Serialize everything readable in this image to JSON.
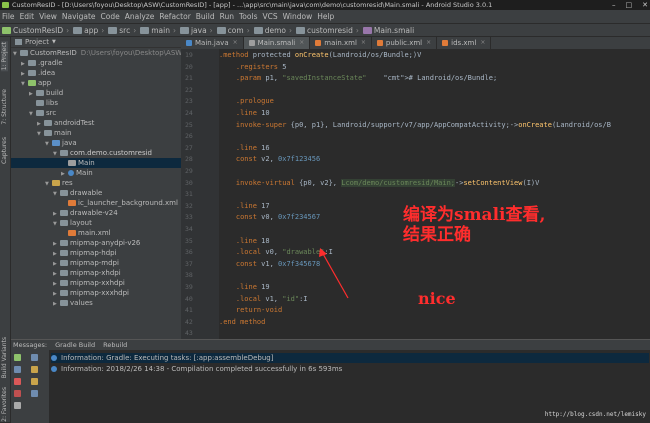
{
  "title": "CustomResID - [D:\\Users\\foyou\\Desktop\\ASW\\CustomResID] - [app] - ...\\app\\src\\main\\java\\com\\demo\\customresid\\Main.smali - Android Studio 3.0.1",
  "menu": [
    "File",
    "Edit",
    "View",
    "Navigate",
    "Code",
    "Analyze",
    "Refactor",
    "Build",
    "Run",
    "Tools",
    "VCS",
    "Window",
    "Help"
  ],
  "breadcrumbs": [
    "CustomResID",
    "app",
    "src",
    "main",
    "java",
    "com",
    "demo",
    "customresid",
    "Main.smali"
  ],
  "side_tabs": {
    "project": "1: Project",
    "structure": "7: Structure",
    "captures": "Captures",
    "favorites": "2: Favorites",
    "build_variants": "Build Variants"
  },
  "project_panel": {
    "title": "Project",
    "tree": [
      {
        "label": "CustomResID",
        "path": "D:\\Users\\foyou\\Desktop\\ASW",
        "depth": 0,
        "expanded": true,
        "icon": "folder-icon"
      },
      {
        "label": ".gradle",
        "depth": 1,
        "expanded": false,
        "icon": "folder-icon"
      },
      {
        "label": ".idea",
        "depth": 1,
        "expanded": false,
        "icon": "folder-icon"
      },
      {
        "label": "app",
        "depth": 1,
        "expanded": true,
        "icon": "module-icon"
      },
      {
        "label": "build",
        "depth": 2,
        "expanded": false,
        "icon": "folder-icon"
      },
      {
        "label": "libs",
        "depth": 2,
        "expanded": null,
        "icon": "folder-icon"
      },
      {
        "label": "src",
        "depth": 2,
        "expanded": true,
        "icon": "folder-icon"
      },
      {
        "label": "androidTest",
        "depth": 3,
        "expanded": false,
        "icon": "folder-icon"
      },
      {
        "label": "main",
        "depth": 3,
        "expanded": true,
        "icon": "folder-icon"
      },
      {
        "label": "java",
        "depth": 4,
        "expanded": true,
        "icon": "source-folder-icon"
      },
      {
        "label": "com.demo.customresid",
        "depth": 5,
        "expanded": true,
        "icon": "package-icon"
      },
      {
        "label": "Main",
        "depth": 6,
        "expanded": null,
        "icon": "smali-file-icon"
      },
      {
        "label": "Main",
        "depth": 6,
        "expanded": false,
        "icon": "class-icon"
      },
      {
        "label": "res",
        "depth": 4,
        "expanded": true,
        "icon": "res-folder-icon"
      },
      {
        "label": "drawable",
        "depth": 5,
        "expanded": true,
        "icon": "folder-icon"
      },
      {
        "label": "ic_launcher_background.xml",
        "depth": 6,
        "expanded": null,
        "icon": "xml-file-icon"
      },
      {
        "label": "drawable-v24",
        "depth": 5,
        "expanded": false,
        "icon": "folder-icon"
      },
      {
        "label": "layout",
        "depth": 5,
        "expanded": true,
        "icon": "folder-icon"
      },
      {
        "label": "main.xml",
        "depth": 6,
        "expanded": null,
        "icon": "xml-file-icon"
      },
      {
        "label": "mipmap-anydpi-v26",
        "depth": 5,
        "expanded": false,
        "icon": "folder-icon"
      },
      {
        "label": "mipmap-hdpi",
        "depth": 5,
        "expanded": false,
        "icon": "folder-icon"
      },
      {
        "label": "mipmap-mdpi",
        "depth": 5,
        "expanded": false,
        "icon": "folder-icon"
      },
      {
        "label": "mipmap-xhdpi",
        "depth": 5,
        "expanded": false,
        "icon": "folder-icon"
      },
      {
        "label": "mipmap-xxhdpi",
        "depth": 5,
        "expanded": false,
        "icon": "folder-icon"
      },
      {
        "label": "mipmap-xxxhdpi",
        "depth": 5,
        "expanded": false,
        "icon": "folder-icon"
      },
      {
        "label": "values",
        "depth": 5,
        "expanded": false,
        "icon": "folder-icon"
      }
    ]
  },
  "tabs": [
    {
      "label": "Main.java",
      "active": false
    },
    {
      "label": "Main.smali",
      "active": true
    },
    {
      "label": "main.xml",
      "active": false
    },
    {
      "label": "public.xml",
      "active": false
    },
    {
      "label": "ids.xml",
      "active": false
    }
  ],
  "code_lines": [
    {
      "n": "19",
      "text": ".method protected onCreate(Landroid/os/Bundle;)V"
    },
    {
      "n": "20",
      "text": "    .registers 5"
    },
    {
      "n": "21",
      "text": "    .param p1, \"savedInstanceState\"    # Landroid/os/Bundle;"
    },
    {
      "n": "22",
      "text": ""
    },
    {
      "n": "23",
      "text": "    .prologue"
    },
    {
      "n": "24",
      "text": "    .line 10"
    },
    {
      "n": "25",
      "text": "    invoke-super {p0, p1}, Landroid/support/v7/app/AppCompatActivity;->onCreate(Landroid/os/B"
    },
    {
      "n": "26",
      "text": ""
    },
    {
      "n": "27",
      "text": "    .line 16"
    },
    {
      "n": "28",
      "text": "    const v2, 0x7f123456"
    },
    {
      "n": "29",
      "text": ""
    },
    {
      "n": "30",
      "text": "    invoke-virtual {p0, v2}, Lcom/demo/customresid/Main;->setContentView(I)V"
    },
    {
      "n": "31",
      "text": ""
    },
    {
      "n": "32",
      "text": "    .line 17"
    },
    {
      "n": "33",
      "text": "    const v0, 0x7f234567"
    },
    {
      "n": "34",
      "text": ""
    },
    {
      "n": "35",
      "text": "    .line 18"
    },
    {
      "n": "36",
      "text": "    .local v0, \"drawable\":I"
    },
    {
      "n": "37",
      "text": "    const v1, 0x7f345678"
    },
    {
      "n": "38",
      "text": ""
    },
    {
      "n": "39",
      "text": "    .line 19"
    },
    {
      "n": "40",
      "text": "    .local v1, \"id\":I"
    },
    {
      "n": "41",
      "text": "    return-void"
    },
    {
      "n": "42",
      "text": ".end method"
    },
    {
      "n": "43",
      "text": ""
    }
  ],
  "annotation": {
    "line1": "编译为smali查看,",
    "line2": "结果正确",
    "nice": "nice"
  },
  "messages": {
    "tabs": [
      "Messages:",
      "Gradle Build",
      "Rebuild"
    ],
    "rows": [
      "Information: Gradle: Executing tasks: [:app:assembleDebug]",
      "Information: 2018/2/26 14:38 - Compilation completed successfully in 6s 593ms"
    ]
  },
  "watermark": "http://blog.csdn.net/lemisky",
  "colors": {
    "keyword": "#cc7832",
    "string": "#6a8759",
    "number": "#6897bb",
    "comment": "#808080",
    "function": "#ffc66d",
    "annotation": "#ff2d2d"
  }
}
